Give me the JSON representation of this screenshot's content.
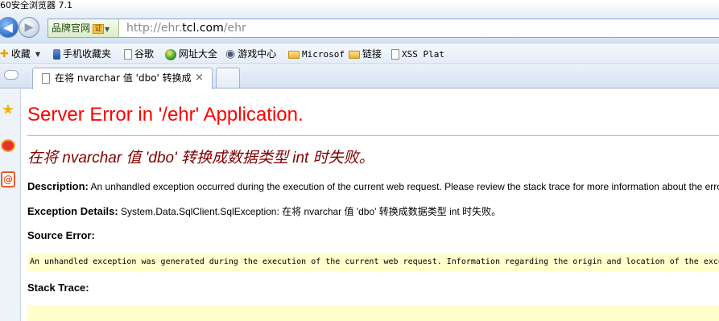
{
  "window": {
    "title": "60安全浏览器 7.1"
  },
  "address_bar": {
    "site_chip": "品牌官网",
    "cert_badge": "证",
    "url_prefix": "http://ehr.",
    "url_domain": "tcl.com",
    "url_suffix": "/ehr"
  },
  "favorites": {
    "items": [
      {
        "label": "收藏",
        "icon": "star-add-icon"
      },
      {
        "label": "手机收藏夹",
        "icon": "phone-icon"
      },
      {
        "label": "谷歌",
        "icon": "page-icon"
      },
      {
        "label": "网址大全",
        "icon": "globe-icon"
      },
      {
        "label": "游戏中心",
        "icon": "gamepad-icon"
      },
      {
        "label": "Microsof",
        "icon": "folder-icon"
      },
      {
        "label": "链接",
        "icon": "folder-icon"
      },
      {
        "label": "XSS Plat",
        "icon": "page-icon"
      }
    ]
  },
  "tabs": [
    {
      "label": "在将 nvarchar 值 'dbo' 转换成",
      "close": "×"
    }
  ],
  "page": {
    "heading": "Server Error in '/ehr' Application.",
    "error_message": "在将 nvarchar 值 'dbo' 转换成数据类型 int 时失败。",
    "description_label": "Description:",
    "description_text": "An unhandled exception occurred during the execution of the current web request. Please review the stack trace for more information about the error",
    "exception_label": "Exception Details:",
    "exception_text": "System.Data.SqlClient.SqlException: 在将 nvarchar 值 'dbo' 转换成数据类型 int 时失败。",
    "source_error_label": "Source Error:",
    "source_error_text": "An unhandled exception was generated during the execution of the current web request. Information regarding the origin and location of the exception",
    "stack_trace_label": "Stack Trace:"
  },
  "colors": {
    "heading": "#ff0000",
    "error_message": "#800000",
    "code_background": "#ffffcc"
  }
}
